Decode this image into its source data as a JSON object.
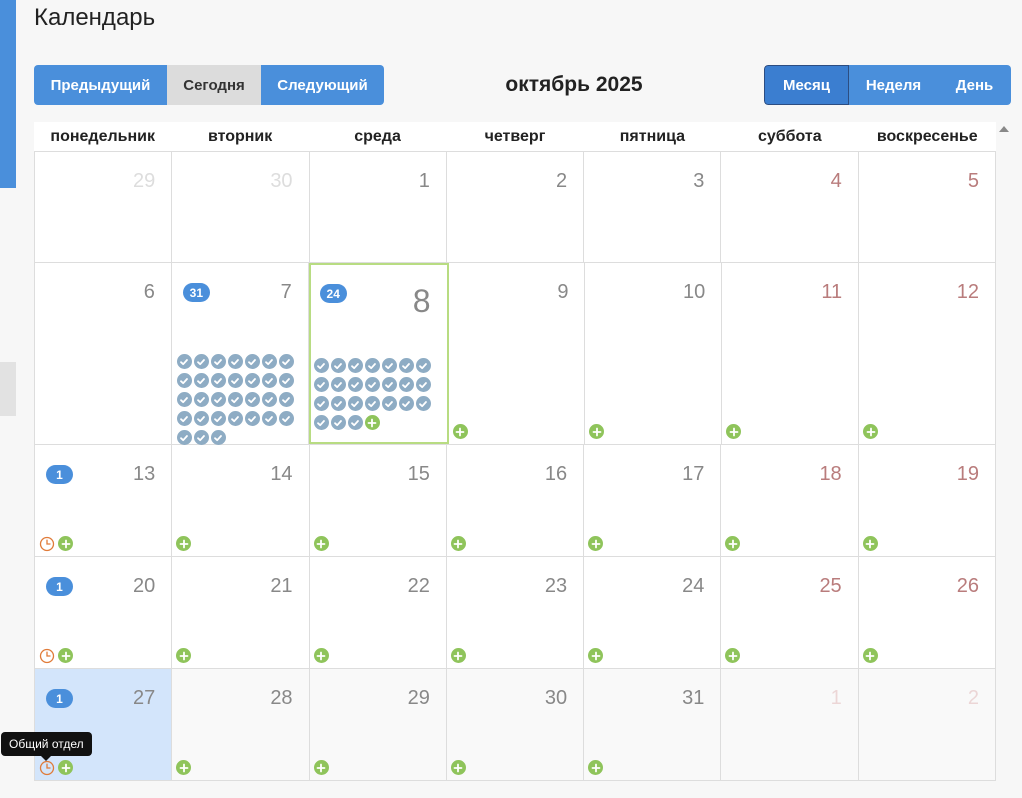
{
  "page": {
    "title": "Календарь"
  },
  "toolbar": {
    "prev_label": "Предыдущий",
    "today_label": "Сегодня",
    "next_label": "Следующий",
    "month_label": "Месяц",
    "week_label": "Неделя",
    "day_label": "День",
    "title": "октябрь 2025"
  },
  "colors": {
    "accent": "#4a8fdb",
    "active": "#3b7ed0",
    "today_border": "#b8dc82",
    "highlight": "#d3e5fb",
    "weekend": "#b97c7c",
    "add": "#8fc45b",
    "check": "#8eacc4",
    "clock": "#e07b39"
  },
  "weekdays": [
    "понедельник",
    "вторник",
    "среда",
    "четверг",
    "пятница",
    "суббота",
    "воскресенье"
  ],
  "tooltip": {
    "text": "Общий отдел"
  },
  "weeks": [
    [
      {
        "day": "29",
        "state": "faded"
      },
      {
        "day": "30",
        "state": "faded"
      },
      {
        "day": "1"
      },
      {
        "day": "2"
      },
      {
        "day": "3"
      },
      {
        "day": "4",
        "weekend": true
      },
      {
        "day": "5",
        "weekend": true
      }
    ],
    [
      {
        "day": "6"
      },
      {
        "day": "7",
        "badge": "31",
        "checks": 31
      },
      {
        "day": "8",
        "badge": "24",
        "checks": 24,
        "today": true,
        "add": true,
        "add_inline": true
      },
      {
        "day": "9",
        "add": true
      },
      {
        "day": "10",
        "add": true
      },
      {
        "day": "11",
        "weekend": true,
        "add": true
      },
      {
        "day": "12",
        "weekend": true,
        "add": true
      }
    ],
    [
      {
        "day": "13",
        "badge": "1",
        "clock": true,
        "add": true
      },
      {
        "day": "14",
        "add": true
      },
      {
        "day": "15",
        "add": true
      },
      {
        "day": "16",
        "add": true
      },
      {
        "day": "17",
        "add": true
      },
      {
        "day": "18",
        "weekend": true,
        "add": true
      },
      {
        "day": "19",
        "weekend": true,
        "add": true
      }
    ],
    [
      {
        "day": "20",
        "badge": "1",
        "clock": true,
        "add": true
      },
      {
        "day": "21",
        "add": true
      },
      {
        "day": "22",
        "add": true
      },
      {
        "day": "23",
        "add": true
      },
      {
        "day": "24",
        "add": true
      },
      {
        "day": "25",
        "weekend": true,
        "add": true
      },
      {
        "day": "26",
        "weekend": true,
        "add": true
      }
    ],
    [
      {
        "day": "27",
        "badge": "1",
        "clock": true,
        "add": true,
        "highlight": true
      },
      {
        "day": "28",
        "add": true
      },
      {
        "day": "29",
        "add": true
      },
      {
        "day": "30",
        "add": true
      },
      {
        "day": "31",
        "add": true
      },
      {
        "day": "1",
        "state": "faded",
        "weekend": true
      },
      {
        "day": "2",
        "state": "faded",
        "weekend": true
      }
    ]
  ]
}
